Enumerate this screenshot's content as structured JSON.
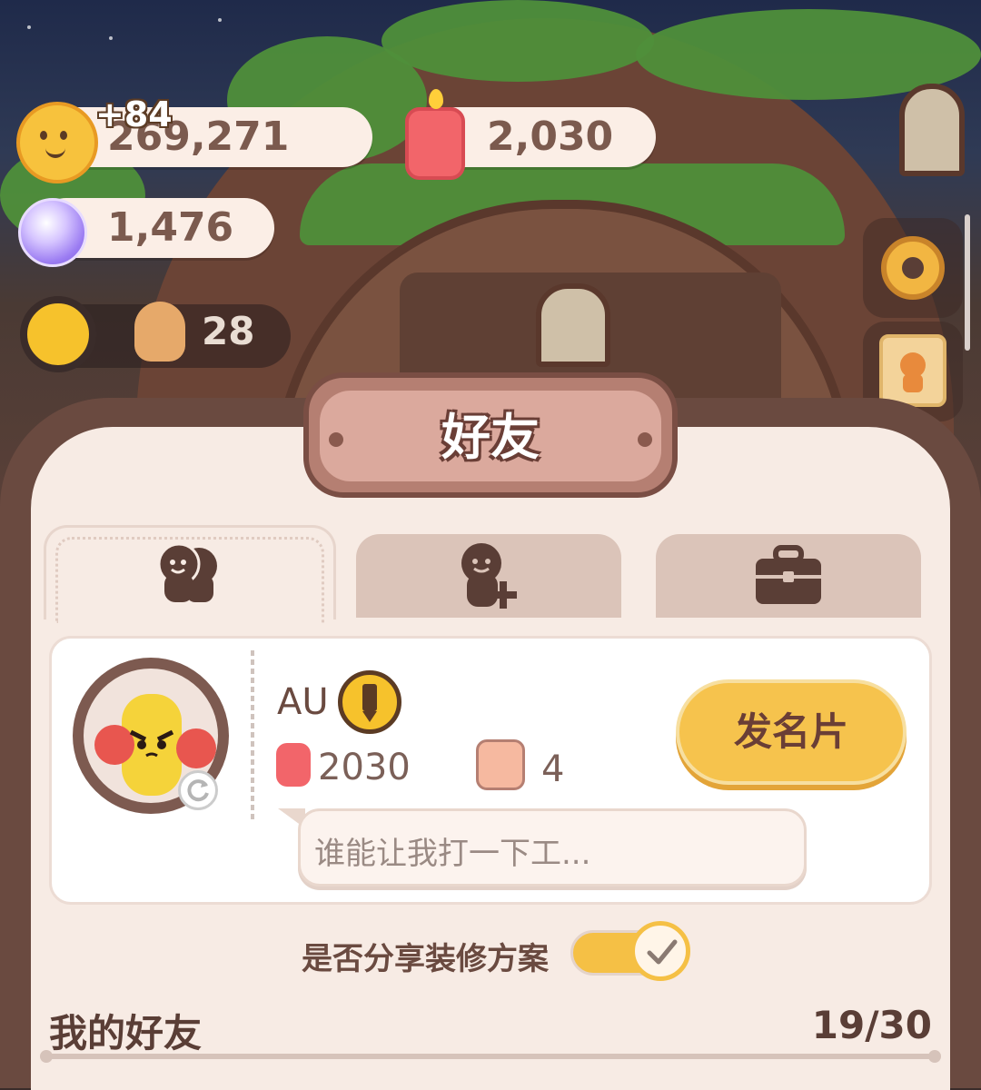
{
  "currency": {
    "cookies": "269,271",
    "cookies_gain": "+84",
    "candles": "2,030",
    "crystals": "1,476"
  },
  "level": "28",
  "panel": {
    "title": "好友",
    "tabs": [
      {
        "icon": "friends-icon"
      },
      {
        "icon": "add-friend-icon"
      },
      {
        "icon": "briefcase-icon"
      }
    ]
  },
  "profile": {
    "username": "AU",
    "candles": "2030",
    "likes": "4",
    "card_button": "发名片",
    "status_message": "谁能让我打一下工..."
  },
  "share": {
    "label": "是否分享装修方案",
    "enabled": true
  },
  "friends": {
    "title": "我的好友",
    "count": "19/30"
  },
  "colors": {
    "accent": "#f6c34d",
    "panel_bg": "#f7ebe4",
    "frame": "#6a4a40"
  }
}
